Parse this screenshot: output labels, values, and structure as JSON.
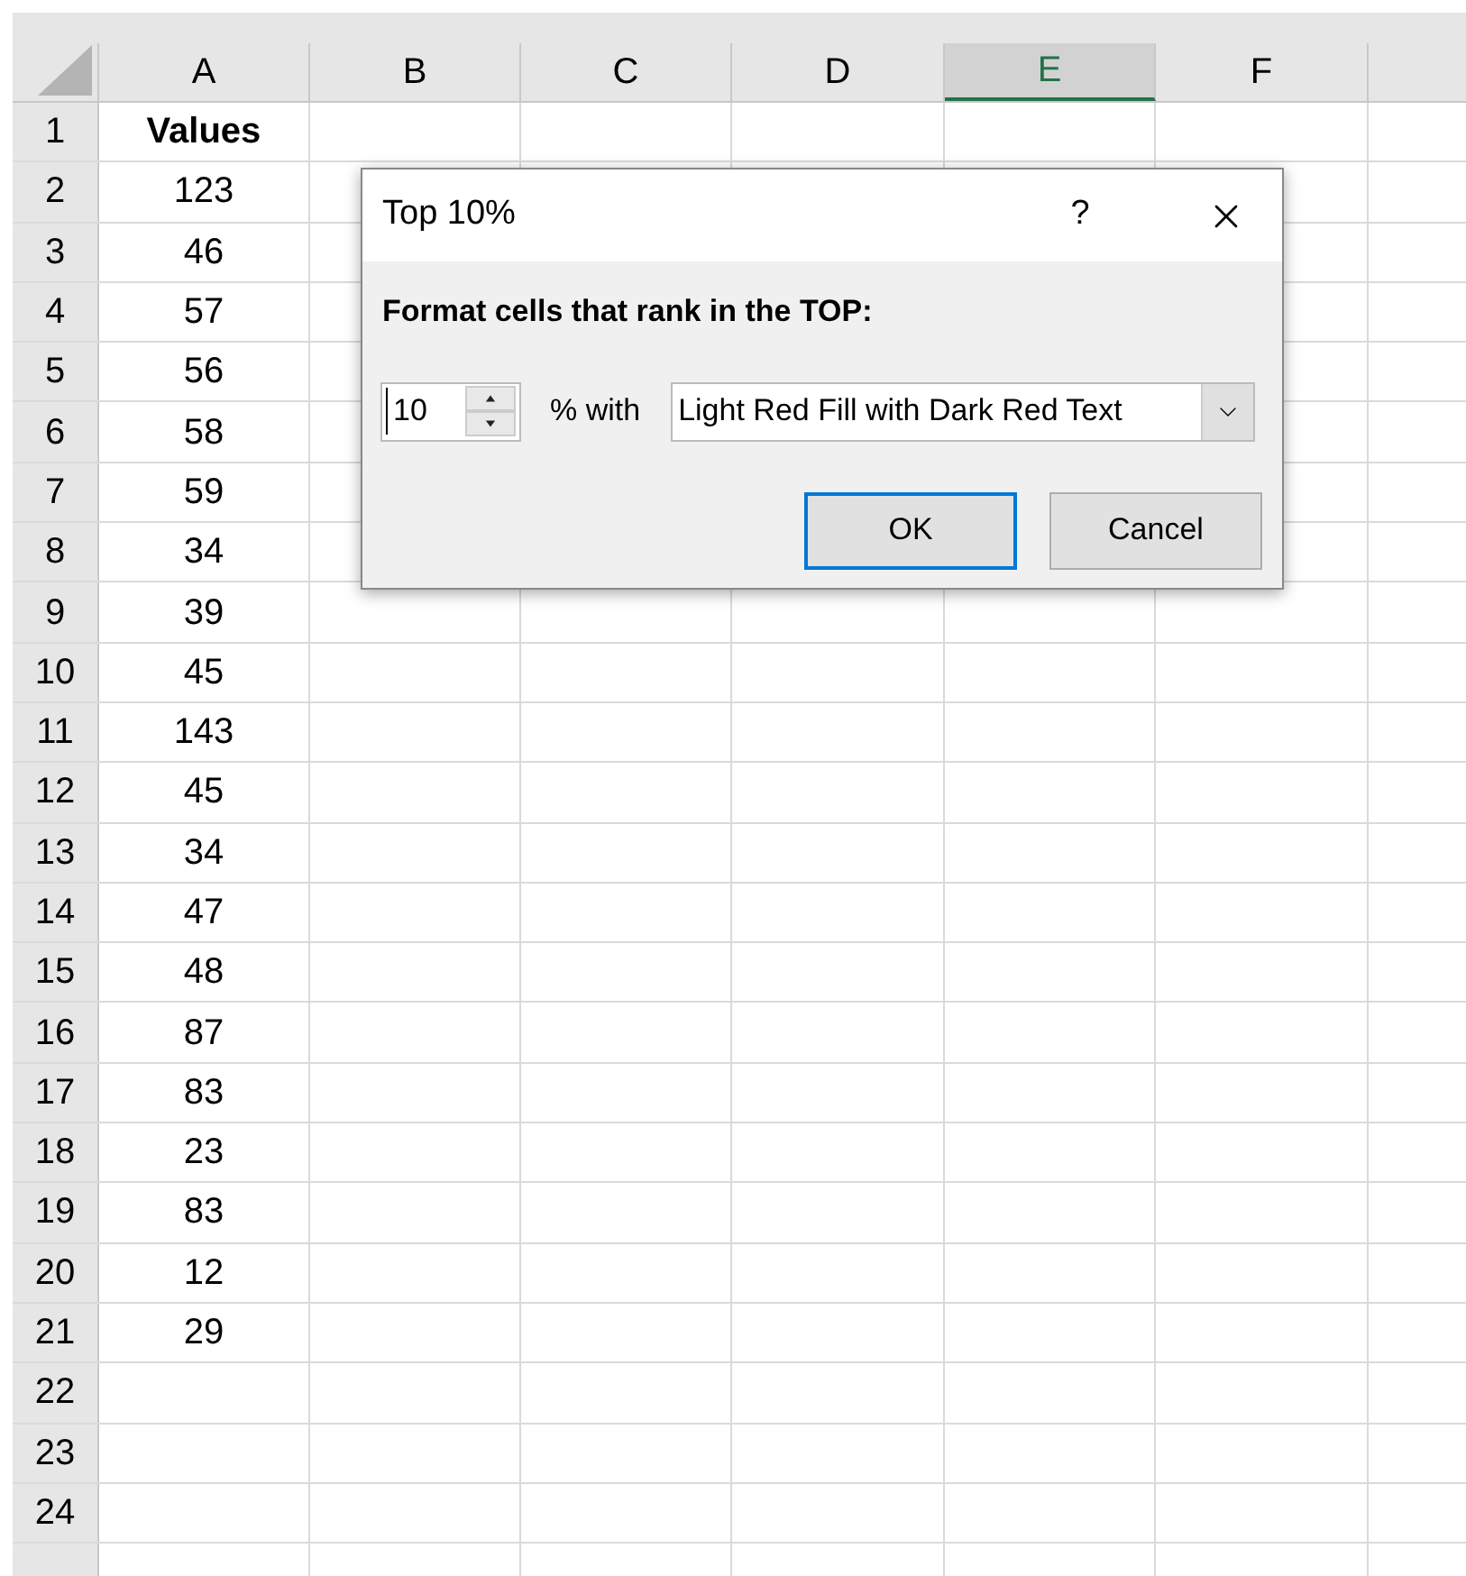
{
  "columns": [
    {
      "label": "A",
      "selected": false
    },
    {
      "label": "B",
      "selected": false
    },
    {
      "label": "C",
      "selected": false
    },
    {
      "label": "D",
      "selected": false
    },
    {
      "label": "E",
      "selected": true
    },
    {
      "label": "F",
      "selected": false
    }
  ],
  "rows": [
    {
      "number": "1",
      "value": "Values",
      "kind": "header"
    },
    {
      "number": "2",
      "value": "123",
      "kind": "value"
    },
    {
      "number": "3",
      "value": "46",
      "kind": "value"
    },
    {
      "number": "4",
      "value": "57",
      "kind": "value"
    },
    {
      "number": "5",
      "value": "56",
      "kind": "value"
    },
    {
      "number": "6",
      "value": "58",
      "kind": "value"
    },
    {
      "number": "7",
      "value": "59",
      "kind": "value"
    },
    {
      "number": "8",
      "value": "34",
      "kind": "value"
    },
    {
      "number": "9",
      "value": "39",
      "kind": "value"
    },
    {
      "number": "10",
      "value": "45",
      "kind": "value"
    },
    {
      "number": "11",
      "value": "143",
      "kind": "value"
    },
    {
      "number": "12",
      "value": "45",
      "kind": "value"
    },
    {
      "number": "13",
      "value": "34",
      "kind": "value"
    },
    {
      "number": "14",
      "value": "47",
      "kind": "value"
    },
    {
      "number": "15",
      "value": "48",
      "kind": "value"
    },
    {
      "number": "16",
      "value": "87",
      "kind": "value"
    },
    {
      "number": "17",
      "value": "83",
      "kind": "value"
    },
    {
      "number": "18",
      "value": "23",
      "kind": "value"
    },
    {
      "number": "19",
      "value": "83",
      "kind": "value"
    },
    {
      "number": "20",
      "value": "12",
      "kind": "value"
    },
    {
      "number": "21",
      "value": "29",
      "kind": "value"
    },
    {
      "number": "22"
    },
    {
      "number": "23"
    },
    {
      "number": "24"
    },
    {}
  ],
  "dialog": {
    "title": "Top 10%",
    "help": "?",
    "heading": "Format cells that rank in the TOP:",
    "spinner_value": "10",
    "with_label": "% with",
    "format": "Light Red Fill with Dark Red Text",
    "buttons": [
      {
        "label": "OK",
        "focused": true
      },
      {
        "label": "Cancel",
        "focused": false
      }
    ]
  }
}
